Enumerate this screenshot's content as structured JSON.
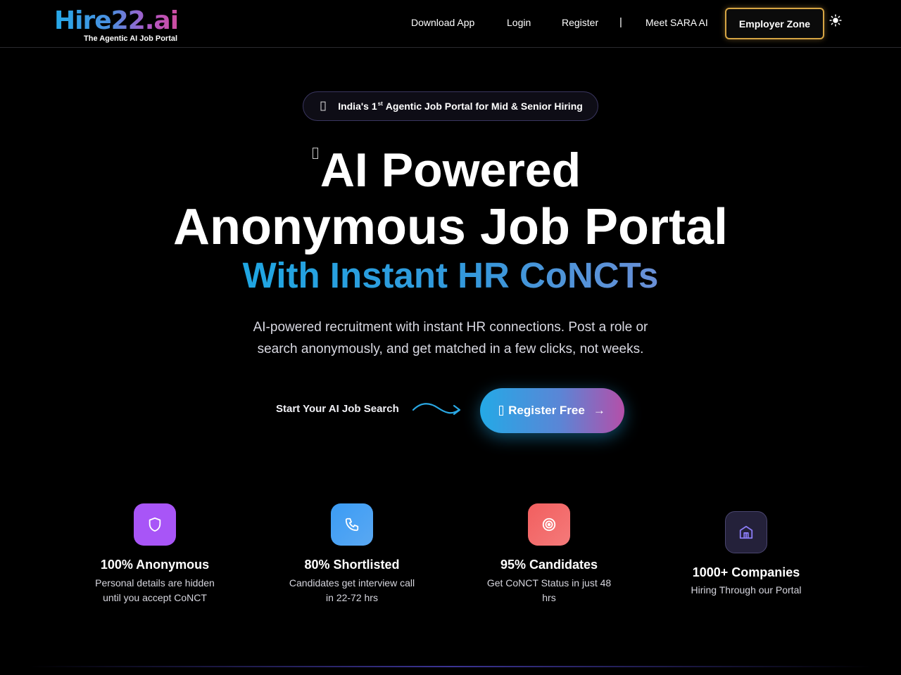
{
  "header": {
    "logo_text": "Hire22.ai",
    "logo_tagline": "The Agentic AI Job Portal",
    "nav": {
      "download_app": "Download App",
      "login": "Login",
      "register": "Register",
      "separator": "|",
      "meet_sara": "Meet SARA AI"
    },
    "employer_zone": "Employer Zone",
    "theme_icon": "sun-icon"
  },
  "hero": {
    "badge": {
      "prefix": "India's 1",
      "superscript": "st",
      "suffix": "Agentic Job Portal for Mid & Senior Hiring"
    },
    "title_line1": "AI Powered",
    "title_line2": "Anonymous Job Portal",
    "title_line3": "With Instant HR CoNCTs",
    "subtitle": "AI-powered recruitment with instant HR connections. Post a role or search anonymously, and get matched in a few clicks, not weeks.",
    "cta_label": "Start Your AI Job Search",
    "register_button": "Register Free",
    "register_arrow": "→"
  },
  "stats": [
    {
      "title": "100% Anonymous",
      "desc": "Personal details are hidden until you accept CoNCT",
      "icon": "shield-icon",
      "color": "#a855f7"
    },
    {
      "title": "80% Shortlisted",
      "desc": "Candidates get interview call in 22-72 hrs",
      "icon": "phone-icon",
      "color": "#3b9cf5"
    },
    {
      "title": "95% Candidates",
      "desc": "Get CoNCT Status in just 48 hrs",
      "icon": "target-icon",
      "color": "#f16868"
    },
    {
      "title": "1000+ Companies",
      "desc": "Hiring Through our Portal",
      "icon": "building-icon",
      "color": "#2a2744"
    }
  ],
  "colors": {
    "background": "#000000",
    "accent_blue": "#24a9e6",
    "accent_pink": "#b44fa9",
    "employer_border": "#d6a544"
  }
}
